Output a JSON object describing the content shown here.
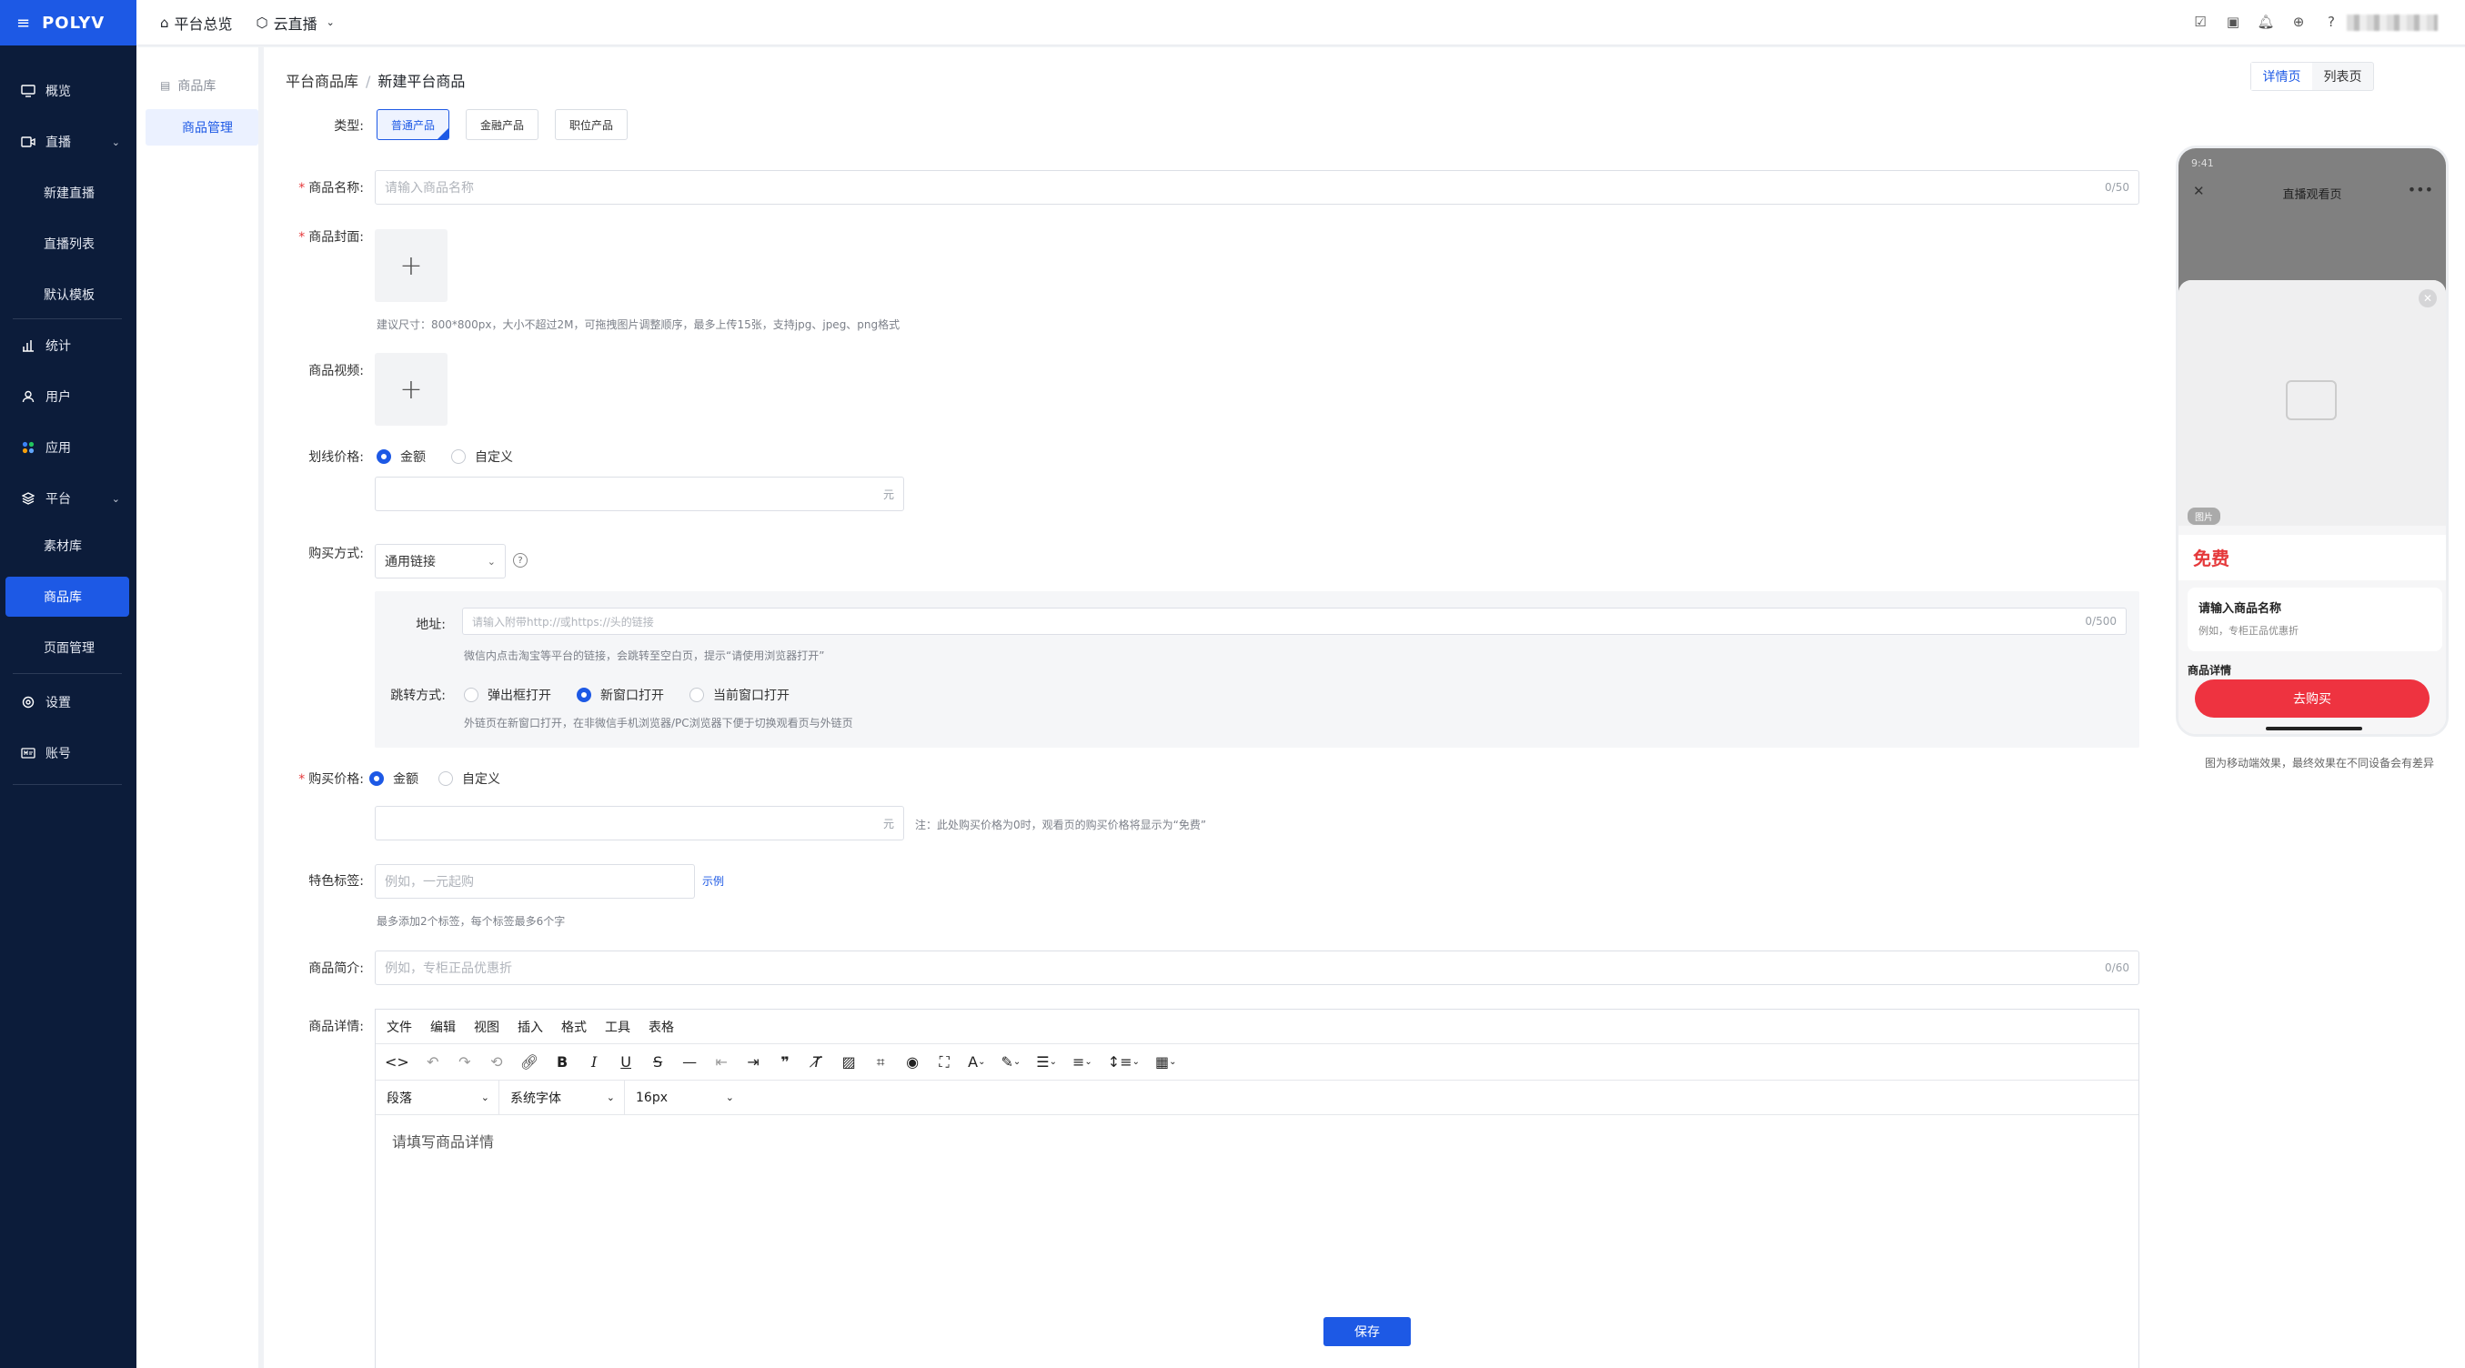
{
  "brand": {
    "logo_text": "POLYV"
  },
  "sidebar": {
    "items": [
      {
        "label": "概览",
        "icon": "monitor-icon"
      },
      {
        "label": "直播",
        "icon": "video-icon"
      },
      {
        "label": "新建直播"
      },
      {
        "label": "直播列表"
      },
      {
        "label": "默认模板"
      },
      {
        "label": "统计",
        "icon": "chart-icon"
      },
      {
        "label": "用户",
        "icon": "user-icon"
      },
      {
        "label": "应用",
        "icon": "apps-icon"
      },
      {
        "label": "平台",
        "icon": "layers-icon"
      },
      {
        "label": "素材库"
      },
      {
        "label": "商品库"
      },
      {
        "label": "页面管理"
      },
      {
        "label": "设置",
        "icon": "gear-icon"
      },
      {
        "label": "账号",
        "icon": "id-card-icon"
      }
    ]
  },
  "topbar": {
    "home": "平台总览",
    "product": "云直播"
  },
  "subnav": {
    "group": "商品库",
    "item": "商品管理"
  },
  "breadcrumb": {
    "parent": "平台商品库",
    "current": "新建平台商品"
  },
  "form": {
    "type": {
      "label": "类型:",
      "options": [
        "普通产品",
        "金融产品",
        "职位产品"
      ],
      "selected": "普通产品"
    },
    "name": {
      "label": "商品名称:",
      "placeholder": "请输入商品名称",
      "count": "0/50"
    },
    "cover": {
      "label": "商品封面:",
      "hint": "建议尺寸：800*800px，大小不超过2M，可拖拽图片调整顺序，最多上传15张，支持jpg、jpeg、png格式"
    },
    "video": {
      "label": "商品视频:"
    },
    "strike_price": {
      "label": "划线价格:",
      "opt1": "金额",
      "opt2": "自定义",
      "unit": "元"
    },
    "buy_method": {
      "label": "购买方式:",
      "value": "通用链接",
      "address_label": "地址:",
      "address_placeholder": "请输入附带http://或https://头的链接",
      "address_count": "0/500",
      "address_hint": "微信内点击淘宝等平台的链接，会跳转至空白页，提示“请使用浏览器打开”",
      "jump_label": "跳转方式:",
      "jump_opts": [
        "弹出框打开",
        "新窗口打开",
        "当前窗口打开"
      ],
      "jump_hint": "外链页在新窗口打开，在非微信手机浏览器/PC浏览器下便于切换观看页与外链页"
    },
    "price": {
      "label": "购买价格:",
      "opt1": "金额",
      "opt2": "自定义",
      "unit": "元",
      "note": "注：此处购买价格为0时，观看页的购买价格将显示为“免费”"
    },
    "tags": {
      "label": "特色标签:",
      "placeholder": "例如，一元起购",
      "example": "示例",
      "hint": "最多添加2个标签，每个标签最多6个字"
    },
    "intro": {
      "label": "商品简介:",
      "placeholder": "例如，专柜正品优惠折",
      "count": "0/60"
    },
    "detail": {
      "label": "商品详情:",
      "menus": [
        "文件",
        "编辑",
        "视图",
        "插入",
        "格式",
        "工具",
        "表格"
      ],
      "block": "段落",
      "font": "系统字体",
      "size": "16px",
      "placeholder": "请填写商品详情"
    },
    "save": "保存"
  },
  "preview": {
    "tabs": [
      "详情页",
      "列表页"
    ],
    "status_time": "9:41",
    "page_title": "直播观看页",
    "badge": "图片",
    "price": "免费",
    "name": "请输入商品名称",
    "intro": "例如，专柜正品优惠折",
    "detail_heading": "商品详情",
    "buy": "去购买",
    "note": "图为移动端效果，最终效果在不同设备会有差异"
  }
}
